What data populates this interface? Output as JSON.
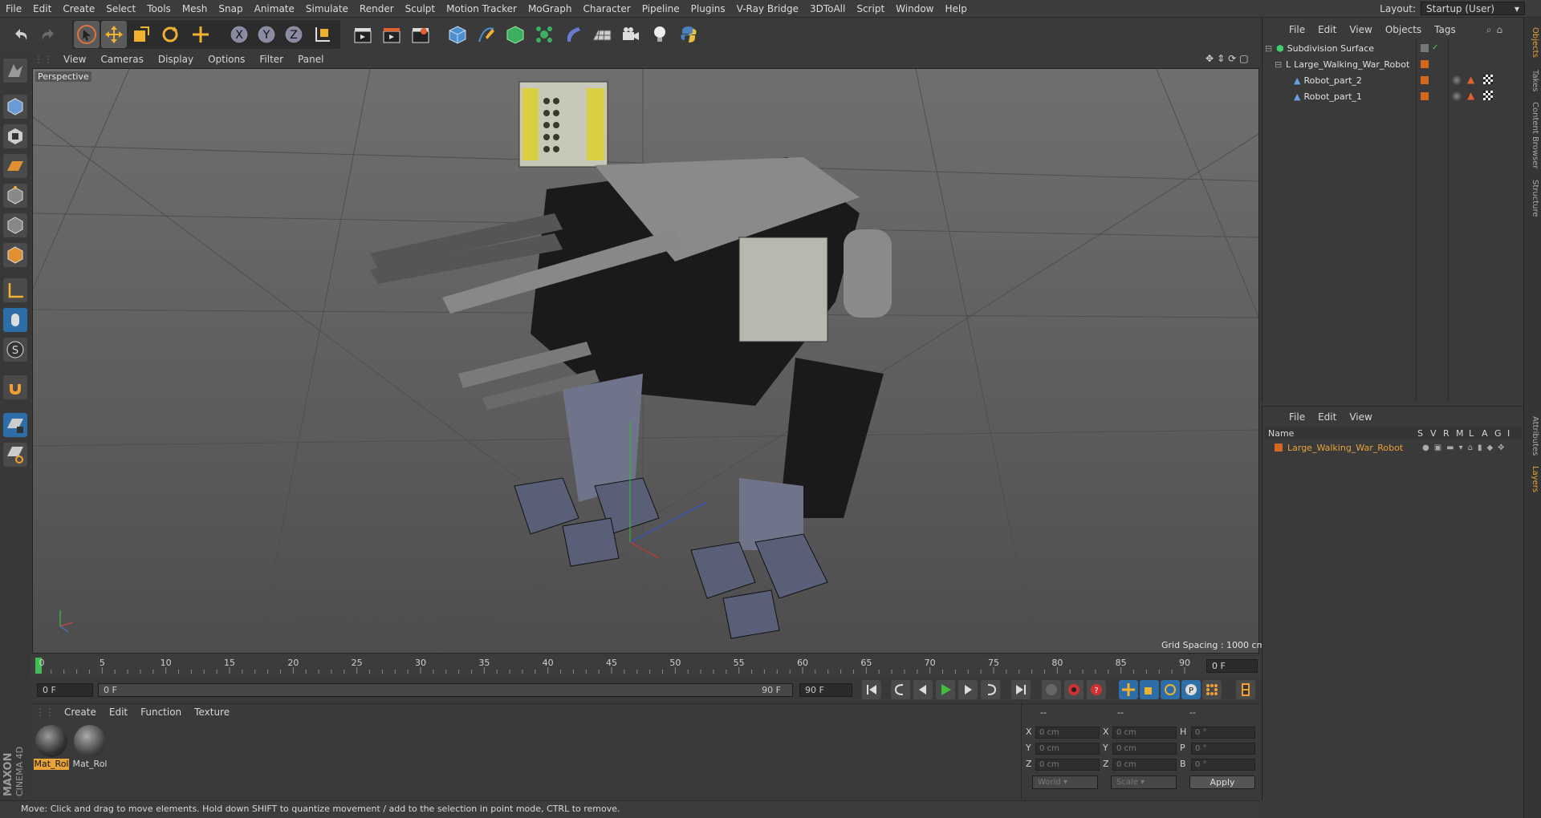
{
  "menubar": {
    "items": [
      "File",
      "Edit",
      "Create",
      "Select",
      "Tools",
      "Mesh",
      "Snap",
      "Animate",
      "Simulate",
      "Render",
      "Sculpt",
      "Motion Tracker",
      "MoGraph",
      "Character",
      "Pipeline",
      "Plugins",
      "V-Ray Bridge",
      "3DToAll",
      "Script",
      "Window",
      "Help"
    ],
    "layout_label": "Layout:",
    "layout_value": "Startup (User)"
  },
  "viewport": {
    "menu": [
      "View",
      "Cameras",
      "Display",
      "Options",
      "Filter",
      "Panel"
    ],
    "label": "Perspective",
    "grid_spacing": "Grid Spacing : 1000 cm"
  },
  "timeline": {
    "ticks": [
      "0",
      "5",
      "10",
      "15",
      "20",
      "25",
      "30",
      "35",
      "40",
      "45",
      "50",
      "55",
      "60",
      "65",
      "70",
      "75",
      "80",
      "85",
      "90"
    ],
    "current_frame_field": "0 F",
    "start_field": "0 F",
    "slider_left": "0 F",
    "slider_right": "90 F",
    "end_field": "90 F"
  },
  "material_manager": {
    "menu": [
      "Create",
      "Edit",
      "Function",
      "Texture"
    ],
    "materials": [
      {
        "label": "Mat_Rol",
        "selected": true
      },
      {
        "label": "Mat_Rol",
        "selected": false
      }
    ]
  },
  "coordinates": {
    "headers": [
      "--",
      "--",
      "--"
    ],
    "rows": [
      {
        "a": "X",
        "av": "0 cm",
        "b": "X",
        "bv": "0 cm",
        "c": "H",
        "cv": "0 °"
      },
      {
        "a": "Y",
        "av": "0 cm",
        "b": "Y",
        "bv": "0 cm",
        "c": "P",
        "cv": "0 °"
      },
      {
        "a": "Z",
        "av": "0 cm",
        "b": "Z",
        "bv": "0 cm",
        "c": "B",
        "cv": "0 °"
      }
    ],
    "world": "World",
    "scale": "Scale",
    "apply": "Apply"
  },
  "statusbar": {
    "text": "Move: Click and drag to move elements. Hold down SHIFT to quantize movement / add to the selection in point mode, CTRL to remove."
  },
  "object_manager": {
    "menu": [
      "File",
      "Edit",
      "View",
      "Objects",
      "Tags"
    ],
    "objects": [
      {
        "name": "Subdivision Surface"
      },
      {
        "name": "Large_Walking_War_Robot"
      },
      {
        "name": "Robot_part_2"
      },
      {
        "name": "Robot_part_1"
      }
    ]
  },
  "layer_manager": {
    "menu": [
      "File",
      "Edit",
      "View"
    ],
    "header": {
      "name": "Name",
      "cols": [
        "S",
        "V",
        "R",
        "M",
        "L",
        "A",
        "G",
        "I"
      ]
    },
    "layers": [
      {
        "name": "Large_Walking_War_Robot"
      }
    ]
  },
  "side_tabs": [
    "Objects",
    "Takes",
    "Content Browser",
    "Structure",
    "Attributes",
    "Layers"
  ],
  "brand": {
    "maxon": "MAXON",
    "product": "CINEMA 4D"
  },
  "colors": {
    "accent": "#e8a33a",
    "orange_tag": "#d2691e",
    "viewport_bg": "#656565"
  }
}
